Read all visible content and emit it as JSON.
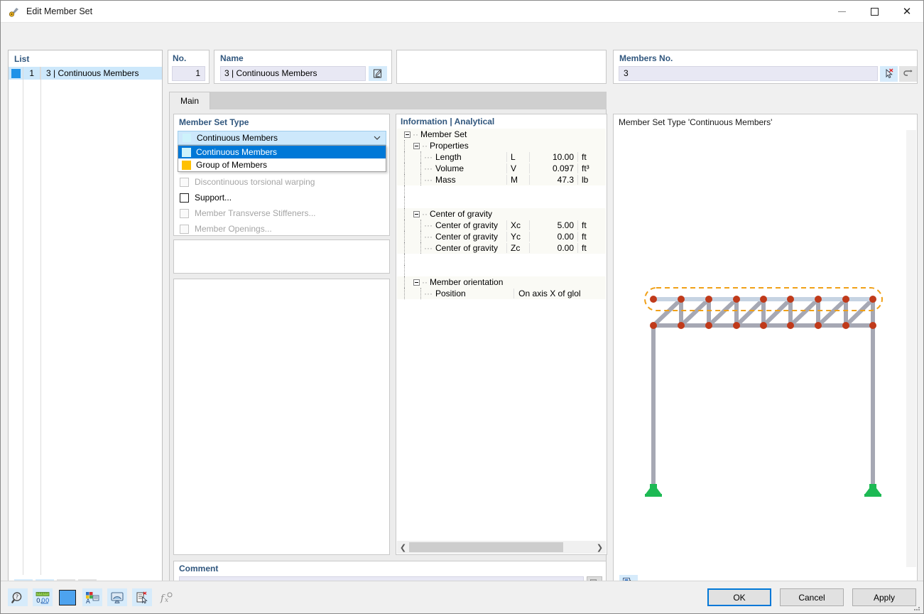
{
  "window": {
    "title": "Edit Member Set",
    "icon": "member-set-icon",
    "minimize": "minimize-icon",
    "maximize": "maximize-icon",
    "close": "close-icon"
  },
  "list": {
    "header": "List",
    "rows": [
      {
        "index": "1",
        "name": "3 | Continuous Members",
        "color": "#1f92e8"
      }
    ],
    "toolbar": [
      {
        "name": "new-member-set-button",
        "icon": "new-window-star-icon",
        "enabled": true
      },
      {
        "name": "copy-member-set-button",
        "icon": "copy-window-icon",
        "enabled": true
      },
      {
        "name": "select-all-button",
        "icon": "checklist-check-icon",
        "enabled": false
      },
      {
        "name": "invert-selection-button",
        "icon": "checklist-swap-icon",
        "enabled": false
      },
      {
        "name": "delete-member-set-button",
        "icon": "red-x-icon",
        "enabled": true
      }
    ]
  },
  "no": {
    "label": "No.",
    "value": "1"
  },
  "name": {
    "label": "Name",
    "value": "3 | Continuous Members",
    "edit_button_icon": "pencil-edit-icon"
  },
  "members": {
    "label": "Members No.",
    "value": "3",
    "pick_button_icon": "pick-cursor-icon",
    "undo_button_icon": "undo-arrow-icon"
  },
  "tabs": [
    {
      "label": "Main",
      "active": true
    }
  ],
  "member_set_type": {
    "label": "Member Set Type",
    "selected": "Continuous Members",
    "selected_color": "#cdf2fb",
    "options": [
      {
        "label": "Continuous Members",
        "color": "#cdf2fb",
        "selected": true
      },
      {
        "label": "Group of Members",
        "color": "#ffc000",
        "selected": false
      }
    ],
    "checkboxes": [
      {
        "label": "Discontinuous torsional warping",
        "checked": false,
        "enabled": false
      },
      {
        "label": "Support...",
        "checked": false,
        "enabled": true
      },
      {
        "label": "Member Transverse Stiffeners...",
        "checked": false,
        "enabled": false
      },
      {
        "label": "Member Openings...",
        "checked": false,
        "enabled": false
      }
    ]
  },
  "comment": {
    "label": "Comment",
    "value": "",
    "dropdown_icon": "chevron-down-icon",
    "copy_icon": "copy-pages-icon"
  },
  "info": {
    "header": "Information | Analytical",
    "root": "Member Set",
    "groups": [
      {
        "title": "Properties",
        "rows": [
          {
            "name": "Length",
            "symbol": "L",
            "value": "10.00",
            "unit": "ft"
          },
          {
            "name": "Volume",
            "symbol": "V",
            "value": "0.097",
            "unit": "ft³"
          },
          {
            "name": "Mass",
            "symbol": "M",
            "value": "47.3",
            "unit": "lb"
          }
        ]
      },
      {
        "title": "Center of gravity",
        "rows": [
          {
            "name": "Center of gravity",
            "symbol": "Xc",
            "value": "5.00",
            "unit": "ft"
          },
          {
            "name": "Center of gravity",
            "symbol": "Yc",
            "value": "0.00",
            "unit": "ft"
          },
          {
            "name": "Center of gravity",
            "symbol": "Zc",
            "value": "0.00",
            "unit": "ft"
          }
        ]
      },
      {
        "title": "Member orientation",
        "rows": [
          {
            "name": "Position",
            "symbol": "",
            "value": "",
            "unit": "",
            "wide_value": "On axis X of glol"
          }
        ]
      }
    ],
    "scroll_left_icon": "chevron-left-icon",
    "scroll_right_icon": "chevron-right-icon"
  },
  "preview": {
    "title": "Member Set Type 'Continuous Members'",
    "toolbar_button_icon": "view-export-icon",
    "model": {
      "highlight_color": "#f0a017",
      "node_color": "#c03a1a",
      "member_color": "#a6a8b4",
      "selected_member_color": "#c6d3e2",
      "support_color": "#1db954",
      "top_chord_nodes": 9,
      "bottom_chord_nodes": 9
    }
  },
  "bottom_toolbar": [
    {
      "name": "help-info-button",
      "icon": "magnifier-question-icon"
    },
    {
      "name": "units-button",
      "icon": "ruler-numbers-icon"
    },
    {
      "name": "color-button",
      "icon": "blue-color-swatch-icon"
    },
    {
      "name": "render-style-button",
      "icon": "render-palette-icon"
    },
    {
      "name": "view-button",
      "icon": "monitor-view-icon"
    },
    {
      "name": "document-select-button",
      "icon": "document-cursor-icon"
    },
    {
      "name": "formula-button",
      "icon": "function-fx-icon"
    }
  ],
  "dialog_buttons": [
    {
      "label": "OK",
      "name": "ok-button",
      "primary": true
    },
    {
      "label": "Cancel",
      "name": "cancel-button",
      "primary": false
    },
    {
      "label": "Apply",
      "name": "apply-button",
      "primary": false
    }
  ]
}
